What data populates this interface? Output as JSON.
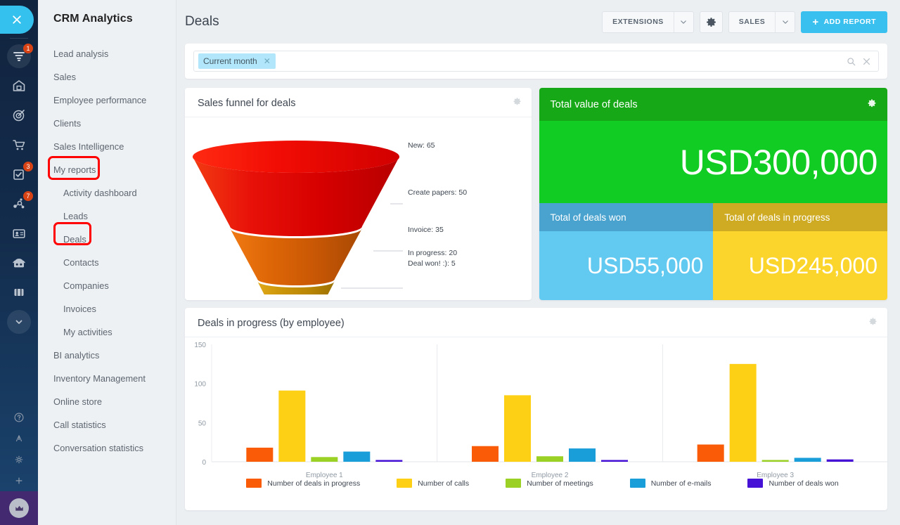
{
  "rail": {
    "close_icon": "close-icon",
    "items": [
      {
        "icon": "funnel-icon",
        "badge": "1"
      },
      {
        "icon": "company-icon",
        "badge": ""
      },
      {
        "icon": "target-icon",
        "badge": ""
      },
      {
        "icon": "cart-icon",
        "badge": ""
      },
      {
        "icon": "tasks-icon",
        "badge": "3"
      },
      {
        "icon": "network-icon",
        "badge": "7"
      },
      {
        "icon": "contacts-icon",
        "badge": ""
      },
      {
        "icon": "bot-icon",
        "badge": ""
      },
      {
        "icon": "drive-icon",
        "badge": ""
      },
      {
        "icon": "chevron-down-circle-icon",
        "badge": ""
      }
    ],
    "bottom": [
      {
        "icon": "help-icon"
      },
      {
        "icon": "automation-icon"
      },
      {
        "icon": "settings-icon"
      },
      {
        "icon": "plus-icon"
      }
    ],
    "crown_icon": "crown-icon"
  },
  "sidebar": {
    "title": "CRM Analytics",
    "items": [
      {
        "label": "Lead analysis",
        "sub": false,
        "highlighted": false
      },
      {
        "label": "Sales",
        "sub": false,
        "highlighted": false
      },
      {
        "label": "Employee performance",
        "sub": false,
        "highlighted": false
      },
      {
        "label": "Clients",
        "sub": false,
        "highlighted": false
      },
      {
        "label": "Sales Intelligence",
        "sub": false,
        "highlighted": false
      },
      {
        "label": "My reports",
        "sub": false,
        "highlighted": true
      },
      {
        "label": "Activity dashboard",
        "sub": true,
        "highlighted": false
      },
      {
        "label": "Leads",
        "sub": true,
        "highlighted": false
      },
      {
        "label": "Deals",
        "sub": true,
        "highlighted": true
      },
      {
        "label": "Contacts",
        "sub": true,
        "highlighted": false
      },
      {
        "label": "Companies",
        "sub": true,
        "highlighted": false
      },
      {
        "label": "Invoices",
        "sub": true,
        "highlighted": false
      },
      {
        "label": "My activities",
        "sub": true,
        "highlighted": false
      },
      {
        "label": "BI analytics",
        "sub": false,
        "highlighted": false
      },
      {
        "label": "Inventory Management",
        "sub": false,
        "highlighted": false
      },
      {
        "label": "Online store",
        "sub": false,
        "highlighted": false
      },
      {
        "label": "Call statistics",
        "sub": false,
        "highlighted": false
      },
      {
        "label": "Conversation statistics",
        "sub": false,
        "highlighted": false
      }
    ],
    "highlight_color": "#ff0000"
  },
  "topbar": {
    "page_title": "Deals",
    "extensions_label": "EXTENSIONS",
    "settings_icon": "gear-icon",
    "sales_label": "SALES",
    "add_report_label": "ADD REPORT",
    "add_report_icon": "plus-icon",
    "accent_color": "#39c0ef"
  },
  "filter": {
    "chip_label": "Current month",
    "chip_remove_icon": "close-icon",
    "search_icon": "search-icon",
    "clear_icon": "close-icon"
  },
  "funnel_card": {
    "title": "Sales funnel for deals",
    "gear_icon": "gear-icon"
  },
  "kpi": {
    "title": "Total value of deals",
    "gear_icon": "gear-icon",
    "total_value": "USD300,000",
    "won_label": "Total of deals won",
    "won_value": "USD55,000",
    "progress_label": "Total of deals in progress",
    "progress_value": "USD245,000",
    "colors": {
      "header_green": "#16a816",
      "body_green": "#11cc22",
      "won_header_blue": "#4aa3cf",
      "won_body_blue": "#62c9f1",
      "progress_header_gold": "#ceab23",
      "progress_body_gold": "#fbd52c"
    }
  },
  "bars_card": {
    "title": "Deals in progress (by employee)",
    "gear_icon": "gear-icon"
  },
  "chart_data": [
    {
      "type": "pie",
      "subtype": "funnel",
      "title": "Sales funnel for deals",
      "categories": [
        "New",
        "Create papers",
        "Invoice",
        "In progress",
        "Deal won! :)"
      ],
      "values": [
        65,
        50,
        35,
        20,
        5
      ],
      "labels": [
        "New: 65",
        "Create papers: 50",
        "Invoice: 35",
        "In progress: 20",
        "Deal won! :): 5"
      ],
      "colors": [
        "#e8140a",
        "#de6606",
        "#c59007",
        "#b6ac06",
        "#a8b300"
      ],
      "legend": "right-callout"
    },
    {
      "type": "bar",
      "title": "Deals in progress (by employee)",
      "categories": [
        "Employee 1",
        "Employee 2",
        "Employee 3"
      ],
      "series": [
        {
          "name": "Number of deals in progress",
          "color": "#f95b06",
          "values": [
            18,
            20,
            22
          ]
        },
        {
          "name": "Number of calls",
          "color": "#fdd016",
          "values": [
            91,
            85,
            125
          ]
        },
        {
          "name": "Number of meetings",
          "color": "#9bd124",
          "values": [
            6,
            7,
            2
          ]
        },
        {
          "name": "Number of e-mails",
          "color": "#1a9ed9",
          "values": [
            13,
            17,
            5
          ]
        },
        {
          "name": "Number of deals won",
          "color": "#4512d6",
          "values": [
            1,
            1,
            3
          ]
        }
      ],
      "xlabel": "",
      "ylabel": "",
      "ylim": [
        0,
        150
      ],
      "yticks": [
        0,
        50,
        100,
        150
      ],
      "grid": false,
      "legend": "bottom"
    }
  ]
}
